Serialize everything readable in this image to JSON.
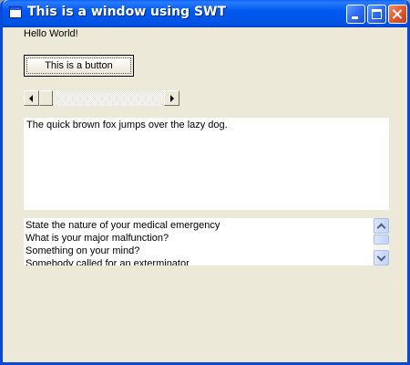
{
  "window": {
    "title": "This is a window using SWT"
  },
  "label": {
    "text": "Hello World!"
  },
  "button": {
    "label": "This is a button"
  },
  "scrollbar": {
    "position": 0
  },
  "textbox": {
    "text": "The quick brown fox jumps over the lazy dog."
  },
  "list": {
    "items": [
      "State the nature of your medical emergency",
      "What is your major malfunction?",
      "Something on your mind?",
      "Somebody called for an exterminator"
    ]
  },
  "colors": {
    "titlebar": "#0054e3",
    "window_bg": "#ece9d8"
  }
}
